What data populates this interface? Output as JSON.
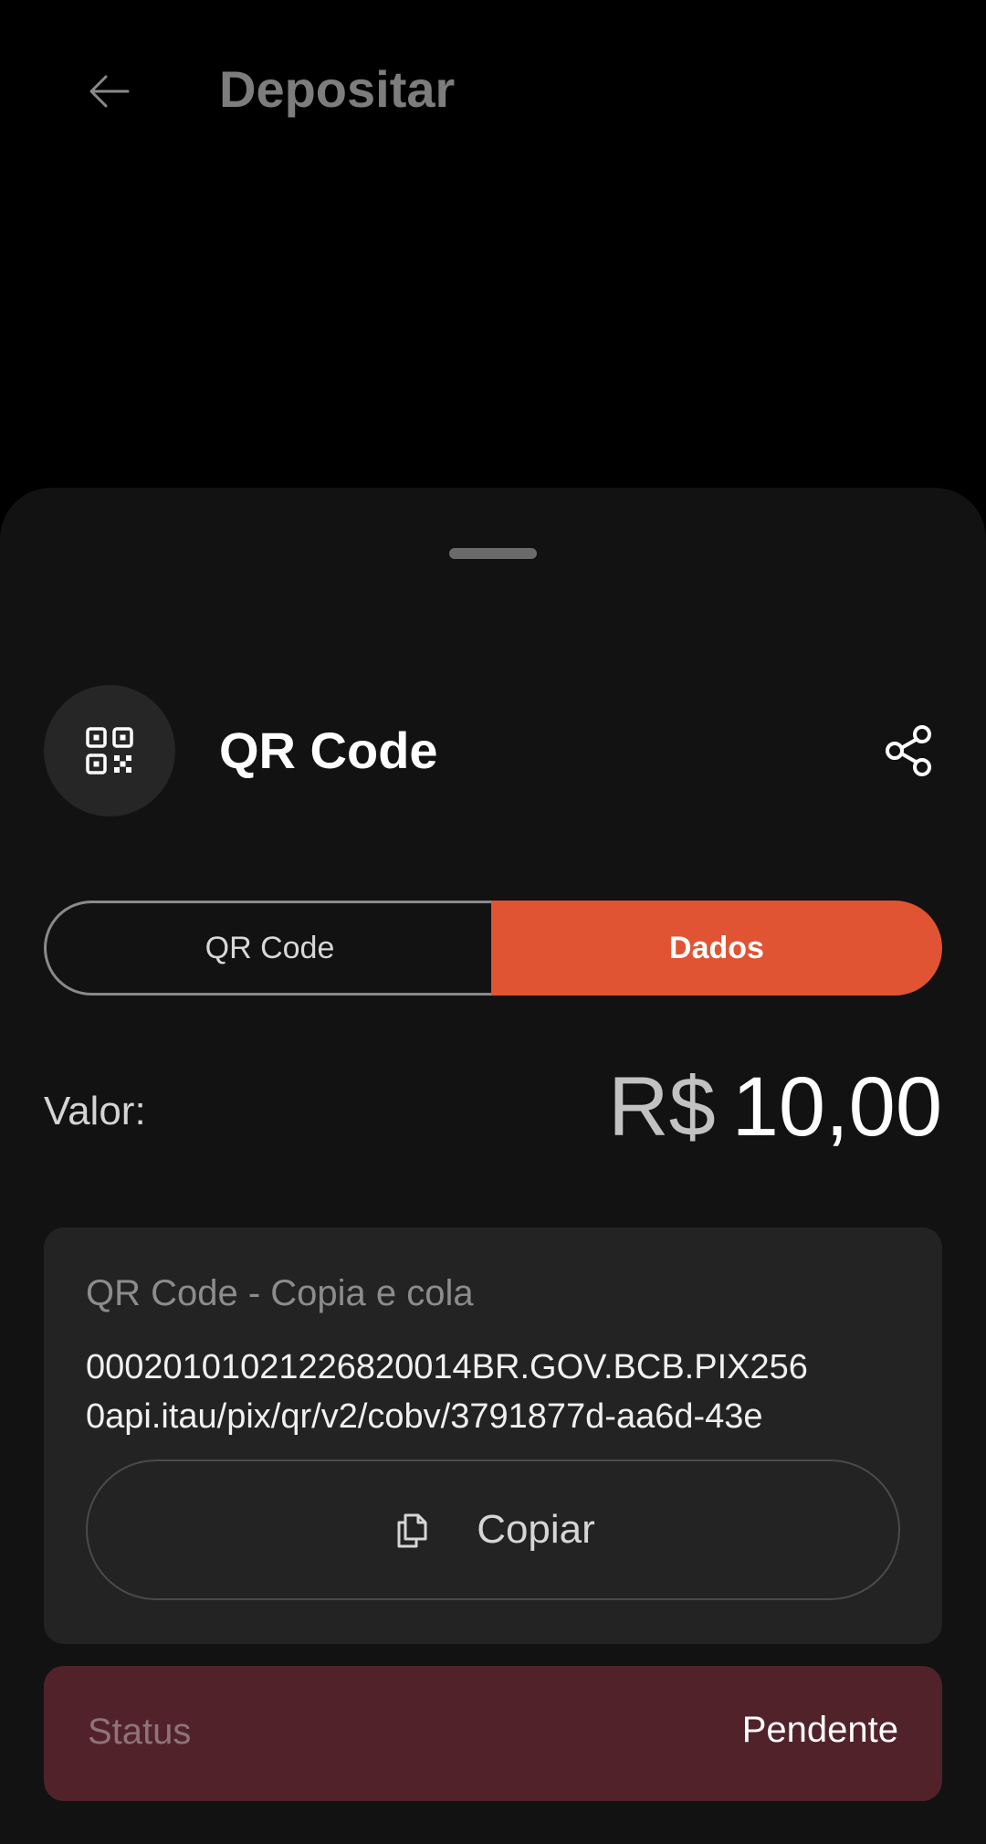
{
  "app_bar": {
    "title": "Depositar",
    "back_icon": "arrow-left-icon"
  },
  "sheet": {
    "title": "QR Code",
    "leading_icon": "qr-code-icon",
    "share_icon": "share-icon",
    "tabs": [
      {
        "label": "QR Code",
        "selected": false
      },
      {
        "label": "Dados",
        "selected": true
      }
    ],
    "amount": {
      "label": "Valor:",
      "currency": "R$",
      "value": "10,00"
    },
    "pix_copy": {
      "title": "QR Code - Copia e cola",
      "code_line_1": "00020101021226820014BR.GOV.BCB.PIX256",
      "code_line_2": "0api.itau/pix/qr/v2/cobv/3791877d-aa6d-43e",
      "copy_label": "Copiar",
      "copy_icon": "copy-icon"
    },
    "status": {
      "label": "Status",
      "value": "Pendente"
    }
  },
  "colors": {
    "accent": "#e05433",
    "status_background": "#52222b",
    "sheet_background": "#121212",
    "card_background": "#232323"
  }
}
